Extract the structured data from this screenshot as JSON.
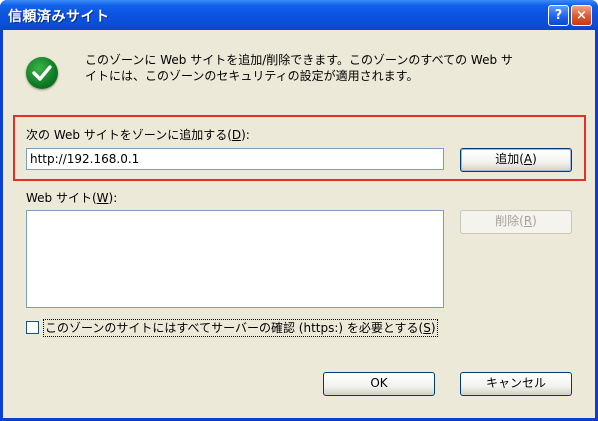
{
  "dialog": {
    "title": "信頼済みサイト",
    "help_label": "?",
    "close_label": "×",
    "info_line1": "このゾーンに Web サイトを追加/削除できます。このゾーンのすべての Web サ",
    "info_line2": "イトには、このゾーンのセキュリティの設定が適用されます。",
    "info_icon": "green-check-icon"
  },
  "add_section": {
    "label_prefix": "次の Web サイトをゾーンに追加する(",
    "label_key": "D",
    "label_suffix": "):",
    "input_value": "http://192.168.0.1",
    "add_button": {
      "prefix": "追加(",
      "key": "A",
      "suffix": ")"
    }
  },
  "websites": {
    "label_prefix": "Web サイト(",
    "label_key": "W",
    "label_suffix": "):",
    "items": [],
    "remove_button": {
      "prefix": "削除(",
      "key": "R",
      "suffix": ")"
    }
  },
  "https_option": {
    "checked": false,
    "label_prefix": "このゾーンのサイトにはすべてサーバーの確認 (https:) を必要とする(",
    "label_key": "S",
    "label_suffix": ")"
  },
  "footer": {
    "ok_label": "OK",
    "cancel_label": "キャンセル"
  },
  "colors": {
    "titlebar": "#0a53e2",
    "highlight_border": "#e03028",
    "dialog_background": "#ece9d8"
  }
}
